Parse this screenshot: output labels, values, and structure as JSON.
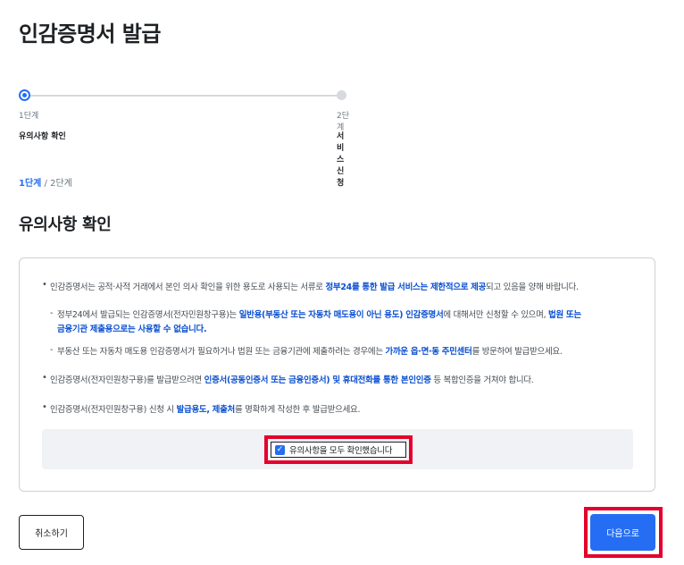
{
  "page": {
    "title": "인감증명서 발급"
  },
  "stepper": {
    "steps": [
      {
        "number": "1단계",
        "name": "유의사항 확인",
        "active": true
      },
      {
        "number": "2단계",
        "name": "서비스 신청",
        "active": false
      }
    ]
  },
  "step_indicator": {
    "current": "1단계",
    "separator": " / ",
    "total": "2단계"
  },
  "section": {
    "title": "유의사항 확인"
  },
  "notices": {
    "item1": {
      "pre": "인감증명서는 공적·사적 거래에서 본인 의사 확인을 위한 용도로 사용되는 서류로 ",
      "hl": "정부24를 통한 발급 서비스는 제한적으로 제공",
      "post": "되고 있음을 양해 바랍니다."
    },
    "sub1": {
      "pre": "정부24에서 발급되는 인감증명서(전자민원창구용)는 ",
      "hl1": "일반용(부동산 또는 자동차 매도용이 아닌 용도) 인감증명서",
      "mid": "에 대해서만 신청할 수 있으며, ",
      "hl2a": "법원 또는",
      "hl2b": "금융기관 제출용으로는 사용할 수 없습니다."
    },
    "sub2": {
      "pre": "부동산 또는 자동차 매도용 인감증명서가 필요하거나 법원 또는 금융기관에 제출하려는 경우에는 ",
      "hl": "가까운 읍·면·동 주민센터",
      "post": "를 방문하여 발급받으세요."
    },
    "item2": {
      "pre": "인감증명서(전자민원창구용)를 발급받으려면 ",
      "hl": "인증서(공동인증서 또는 금융인증서) 및 휴대전화를 통한 본인인증",
      "post": " 등 복합인증을 거쳐야 합니다."
    },
    "item3": {
      "pre": "인감증명서(전자민원창구용) 신청 시 ",
      "hl": "발급용도, 제출처",
      "post": "를 명확하게 작성한 후 발급받으세요."
    }
  },
  "confirm": {
    "label": "유의사항을 모두 확인했습니다",
    "checked": true
  },
  "buttons": {
    "cancel": "취소하기",
    "next": "다음으로"
  },
  "colors": {
    "primary": "#256ef4",
    "highlight_text": "#0b50d0",
    "annotation_red": "#e4002b"
  },
  "icons": {
    "check": "check-icon",
    "bullet": "bullet-icon"
  }
}
